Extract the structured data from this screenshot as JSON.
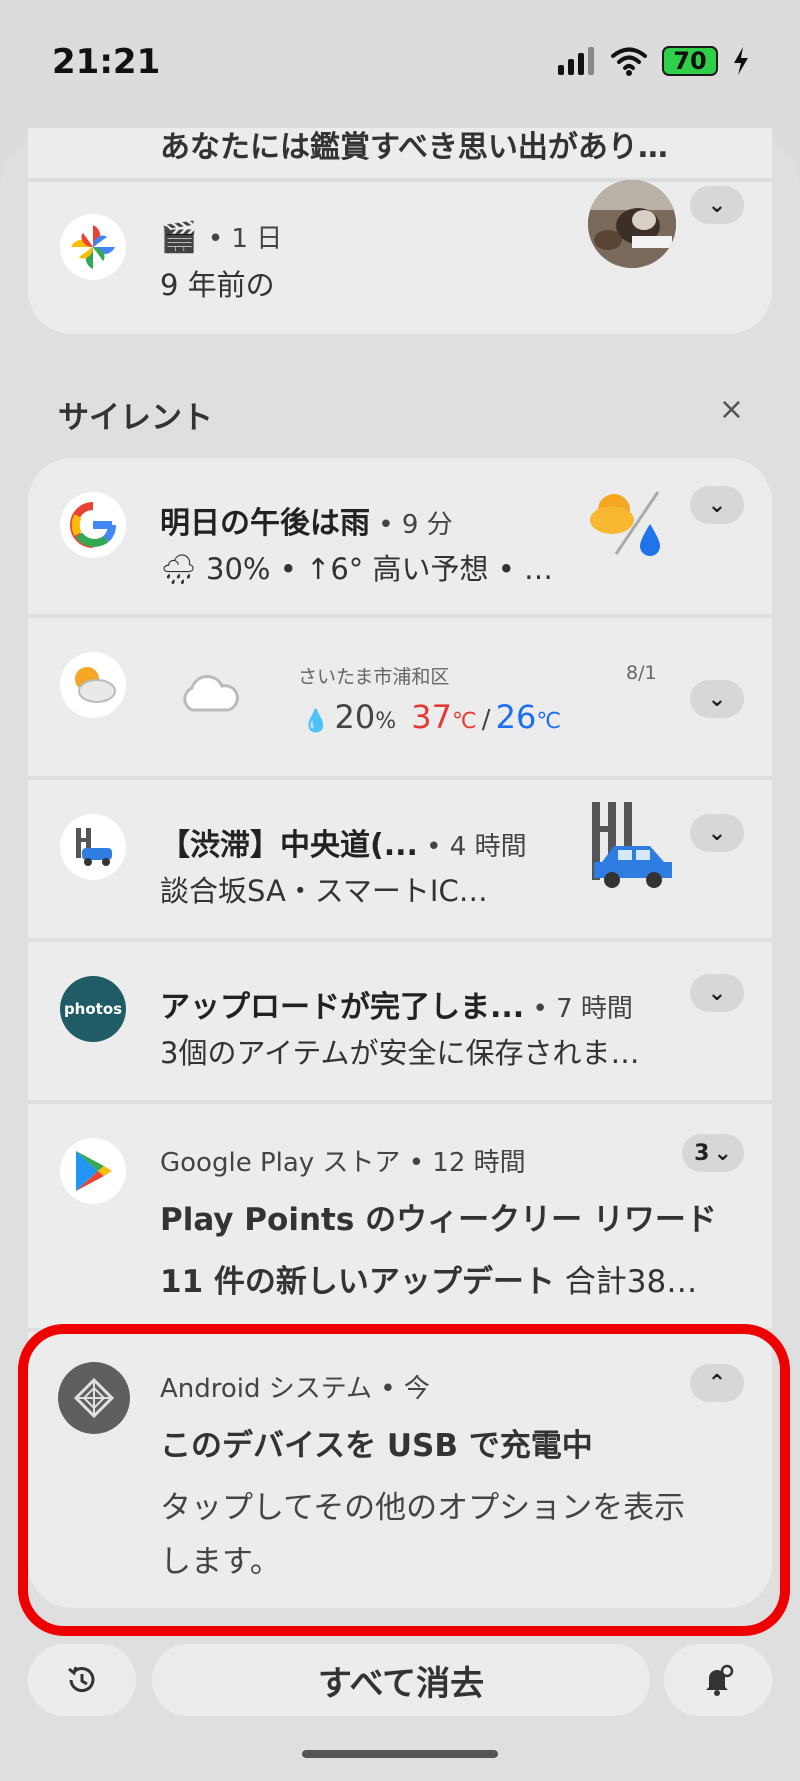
{
  "status_bar": {
    "time": "21:21",
    "battery": "70"
  },
  "top_group": {
    "cut_text": "あなたには鑑賞すべき思い出があり…",
    "photos_card": {
      "emoji": "🎬",
      "meta": "• 1 日",
      "text": "9 年前の"
    }
  },
  "section": {
    "title": "サイレント",
    "close": "×"
  },
  "notifications": [
    {
      "id": "google",
      "title": "明日の午後は雨",
      "meta": " • 9 分",
      "text": "🌧 30% • ↑6° 高い予想 • …"
    },
    {
      "id": "weather",
      "location": "さいたま市浦和区",
      "date": "8/1",
      "precip": "20",
      "precip_unit": "%",
      "high": "37",
      "high_unit": "℃",
      "sep": "/",
      "low": "26",
      "low_unit": "℃"
    },
    {
      "id": "traffic",
      "title": "【渋滞】中央道(...",
      "meta": " • 4 時間",
      "text": "談合坂SA・スマートIC…"
    },
    {
      "id": "amazon-photos",
      "icon_text": "photos",
      "title": "アップロードが完了しま...",
      "meta": " • 7 時間",
      "text": "3個のアイテムが安全に保存されま…"
    },
    {
      "id": "play-store",
      "app": "Google Play ストア • 12 時間",
      "count": "3",
      "line1": "Play Points のウィークリー リワード",
      "line2_bold": "11 件の新しいアップデート",
      "line2_rest": " 合計38…"
    },
    {
      "id": "android-system",
      "app": "Android システム • 今",
      "title": "このデバイスを USB で充電中",
      "text1": "タップしてその他のオプションを表示",
      "text2": "します。"
    }
  ],
  "bottom": {
    "clear_all": "すべて消去"
  },
  "colors": {
    "highlight": "#ee0000",
    "temp_high": "#e53935",
    "temp_low": "#1e6ff0"
  }
}
